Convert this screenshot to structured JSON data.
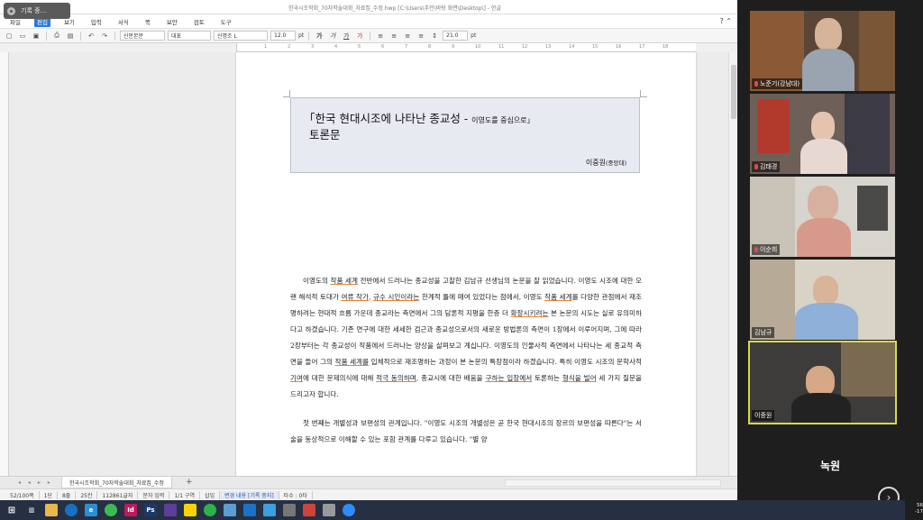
{
  "window": {
    "title": "한국시조학회_70차학술대회_자료집_수정.hwp [C:\\Users\\추인\\바탕 화면\\Desktop\\] - 한글",
    "recording_badge": "기록 중..."
  },
  "menu": {
    "items": [
      "파일",
      "편집",
      "보기",
      "입력",
      "서식",
      "쪽",
      "보안",
      "검토",
      "도구"
    ],
    "active": "편집",
    "right_controls": "? ⌃"
  },
  "toolbar": {
    "style_combo": "신문본문",
    "lang_combo": "대표",
    "font_combo": "신명조 L",
    "font_size": "12.0",
    "size_unit": "pt",
    "line_spacing": "21.0",
    "spacing_unit": "pt",
    "format_glyphs": [
      "가",
      "가",
      "가",
      "가"
    ]
  },
  "ruler": {
    "ticks": [
      "1",
      "2",
      "3",
      "4",
      "5",
      "6",
      "7",
      "8",
      "9",
      "10",
      "11",
      "12",
      "13",
      "14",
      "15",
      "16",
      "17",
      "18"
    ]
  },
  "document": {
    "title_line1": "「한국 현대시조에 나타난 종교성 -",
    "title_line1_sub": "이영도를 중심으로」",
    "title_line2": "토론문",
    "author": "이중원",
    "affiliation": "(중앙대)",
    "paragraph1": [
      {
        "t": "이영도의 "
      },
      {
        "t": "작품 세계",
        "u": true
      },
      {
        "t": " 전반에서 드러나는 종교성을 고찰한 김남규 선생님의 논문을 잘 읽었습니다. 이영도 시조에 대한 오랜 해석적 토대가 "
      },
      {
        "t": "여류 작가",
        "u": true
      },
      {
        "t": ", "
      },
      {
        "t": "규수 시인이라는",
        "u": true
      },
      {
        "t": " 한계적 틀에 매여 있었다는 점에서, 이영도 "
      },
      {
        "t": "작품 세계",
        "u": true
      },
      {
        "t": "를 다양한 관점에서 재조명하려는 현대적 흐름 가운데 종교라는 측면에서 그의 담론적 지평을 한층 더 "
      },
      {
        "t": "확장시키려는",
        "u": true
      },
      {
        "t": " 본 논문의 시도는 실로 유의미하다고 하겠습니다. 기존 연구에 대한 세세한 검근과 종교성으로서의 새로운 방법론의 측면이 1장에서 이루어지며, 그에 따라 2장부터는 각 종교성이 작품에서 드러나는 양상을 살펴보고 계십니다. 이영도의 인물사적 측면에서 나타나는 세 종교적 측면을 들어 그의 "
      },
      {
        "t": "작품 세계를",
        "u": true
      },
      {
        "t": " 입체적으로 재조명하는 과정이 본 논문의 특장점이라 하겠습니다. 특히 이영도 시조의 문학사적 "
      },
      {
        "t": "기여",
        "u": true
      },
      {
        "t": "에 대한 문제의식에 대해 "
      },
      {
        "t": "적극 동의하며",
        "u": true
      },
      {
        "t": ", 종교시에 대한 배움을 "
      },
      {
        "t": "구하는 입장에서",
        "u": true
      },
      {
        "t": " 토론하는 "
      },
      {
        "t": "형식을 빌어",
        "u": true
      },
      {
        "t": " 세 가지 질문을 드리고자 합니다."
      }
    ],
    "paragraph2": "첫 번째는 개별성과 보편성의 관계입니다. \"이영도 시조의 개별성은 곧 한국 현대시조의 장르의 보편성을 따른다\"는 서술을 동상적으로 이해할 수 있는 포함 관계를 다루고 있습니다. \"별 양"
  },
  "tabs": {
    "nav_arrows": "◂ ◂ ▸ ▸",
    "doc_tab": "한국시조학회_70자학술대회_자료집_수정",
    "add": "+"
  },
  "status": {
    "items": [
      "52/100쪽",
      "1단",
      "8줄",
      "25칸",
      "112861글자",
      "문자 입력",
      "1/1 구역",
      "삽입",
      "변경 내용 [기록 중지]",
      "타수 : 0타"
    ],
    "highlight_index": 8
  },
  "zoom": {
    "participants": [
      {
        "name": "노준기(강남대)",
        "muted": true,
        "speaking": false
      },
      {
        "name": "김태경",
        "muted": true,
        "speaking": false
      },
      {
        "name": "이순희",
        "muted": true,
        "speaking": false
      },
      {
        "name": "김남규",
        "muted": false,
        "speaking": false
      },
      {
        "name": "이중원",
        "muted": false,
        "speaking": true
      }
    ],
    "recording_label": "녹원",
    "next_glyph": "›"
  },
  "clock": {
    "time": "56",
    "date": "-17"
  },
  "colors": {
    "accent": "#2b7bd6",
    "underline": "#e0833a",
    "title_box_bg": "#e8eaf2",
    "speaker_outline": "#d9d94a",
    "taskbar": "#263042"
  }
}
